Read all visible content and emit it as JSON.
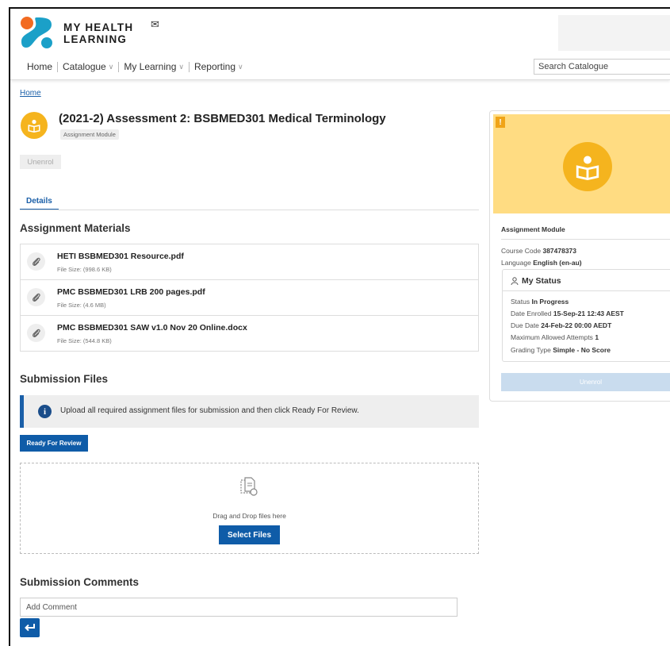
{
  "header": {
    "brand_line1": "MY HEALTH",
    "brand_line2": "LEARNING",
    "nav": [
      {
        "label": "Home"
      },
      {
        "label": "Catalogue"
      },
      {
        "label": "My Learning"
      },
      {
        "label": "Reporting"
      }
    ],
    "search_placeholder": "Search Catalogue"
  },
  "breadcrumb": "Home",
  "page": {
    "title": "(2021-2) Assessment 2: BSBMED301 Medical Terminology",
    "chip": "Assignment Module",
    "unenrol_label": "Unenrol",
    "tab_details": "Details"
  },
  "materials": {
    "heading": "Assignment Materials",
    "files": [
      {
        "name": "HETI BSBMED301 Resource.pdf",
        "size": "File Size: (998.6 KB)"
      },
      {
        "name": "PMC BSBMED301 LRB 200 pages.pdf",
        "size": "File Size: (4.6 MB)"
      },
      {
        "name": "PMC BSBMED301 SAW v1.0 Nov 20 Online.docx",
        "size": "File Size: (544.8 KB)"
      }
    ]
  },
  "submission": {
    "heading": "Submission Files",
    "info_text": "Upload all required assignment files for submission and then click Ready For Review.",
    "ready_label": "Ready For Review",
    "drop_text": "Drag and Drop files here",
    "select_label": "Select Files"
  },
  "comments": {
    "heading": "Submission Comments",
    "placeholder": "Add Comment"
  },
  "card": {
    "type": "Assignment Module",
    "course_code_label": "Course Code",
    "course_code": "387478373",
    "language_label": "Language",
    "language": "English (en-au)",
    "status_title": "My Status",
    "status_label": "Status",
    "status": "In Progress",
    "enrolled_label": "Date Enrolled",
    "enrolled": "15-Sep-21 12:43 AEST",
    "due_label": "Due Date",
    "due": "24-Feb-22 00:00 AEDT",
    "attempts_label": "Maximum Allowed Attempts",
    "attempts": "1",
    "grading_label": "Grading Type",
    "grading": "Simple - No Score",
    "unenrol_label": "Unenrol"
  },
  "colors": {
    "accent_blue": "#0f5ca8",
    "module_yellow": "#f5b41e",
    "banner_yellow": "#ffdc82",
    "logo_orange": "#f26b21",
    "logo_teal": "#1ba0c8"
  }
}
